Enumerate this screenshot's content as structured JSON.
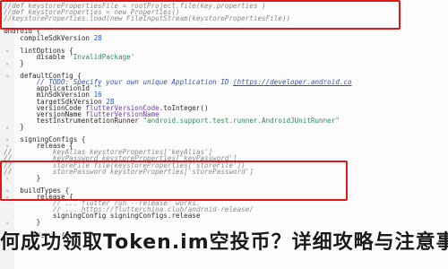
{
  "editor": {
    "lines": [
      {
        "indent": "",
        "text": "//def keystorePropertiesFile = rootProject.file(key.properties )",
        "type": "comment"
      },
      {
        "indent": "",
        "text": "//def keystoreProperties = new Properties()",
        "type": "comment"
      },
      {
        "indent": "",
        "text": "//keystoreProperties.load(new FileInputStream(keystorePropertiesFile))",
        "type": "comment"
      },
      {
        "indent": "",
        "text": "",
        "type": "blank"
      },
      {
        "indent": "",
        "text": "android {",
        "type": "code"
      },
      {
        "indent": "    ",
        "text": "compileSdkVersion 28",
        "type": "code"
      },
      {
        "indent": "",
        "text": "",
        "type": "blank"
      },
      {
        "indent": "    ",
        "text": "lintOptions {",
        "type": "code"
      },
      {
        "indent": "        ",
        "text": "disable 'InvalidPackage'",
        "type": "code"
      },
      {
        "indent": "    ",
        "text": "}",
        "type": "code"
      },
      {
        "indent": "",
        "text": "",
        "type": "blank"
      },
      {
        "indent": "    ",
        "text": "defaultConfig {",
        "type": "code"
      },
      {
        "indent": "        ",
        "text": "// TODO: Specify your own unique Application ID (https://developer.android.co",
        "type": "todo"
      },
      {
        "indent": "        ",
        "text": "applicationId \"\"",
        "type": "code"
      },
      {
        "indent": "        ",
        "text": "minSdkVersion 16",
        "type": "code"
      },
      {
        "indent": "        ",
        "text": "targetSdkVersion 28",
        "type": "code"
      },
      {
        "indent": "        ",
        "text": "versionCode flutterVersionCode.toInteger()",
        "type": "code"
      },
      {
        "indent": "        ",
        "text": "versionName flutterVersionName",
        "type": "code"
      },
      {
        "indent": "        ",
        "text": "testInstrumentationRunner \"android.support.test.runner.AndroidJUnitRunner\"",
        "type": "code"
      },
      {
        "indent": "    ",
        "text": "}",
        "type": "code"
      },
      {
        "indent": "",
        "text": "",
        "type": "blank"
      },
      {
        "indent": "    ",
        "text": "signingConfigs {",
        "type": "code"
      },
      {
        "indent": "        ",
        "text": "release {",
        "type": "code"
      },
      {
        "indent": "//          ",
        "text": "keyAlias keystoreProperties['keyAlias']",
        "type": "comment"
      },
      {
        "indent": "//          ",
        "text": "keyPassword keystoreProperties['keyPassword']",
        "type": "comment"
      },
      {
        "indent": "//          ",
        "text": "storeFile file(keystoreProperties['storeFile'])",
        "type": "comment"
      },
      {
        "indent": "//          ",
        "text": "storePassword keystoreProperties['storePassword']",
        "type": "comment"
      },
      {
        "indent": "        ",
        "text": "}",
        "type": "code"
      },
      {
        "indent": "",
        "text": "",
        "type": "blank"
      },
      {
        "indent": "    ",
        "text": "buildTypes {",
        "type": "code"
      },
      {
        "indent": "        ",
        "text": "release {",
        "type": "code"
      },
      {
        "indent": "            ",
        "text": "// ... flutter run --release' works.",
        "type": "comment"
      },
      {
        "indent": "            ",
        "text": "// ... https://flutterchina.club/android-release/",
        "type": "comment"
      },
      {
        "indent": "            ",
        "text": "signingConfig signingConfigs.release",
        "type": "code"
      },
      {
        "indent": "        ",
        "text": "}",
        "type": "code"
      },
      {
        "indent": "",
        "text": "",
        "type": "blank"
      },
      {
        "indent": "        ",
        "text": "debug {",
        "type": "code"
      }
    ]
  },
  "caption": {
    "text": "何成功领取Token.im空投币？详细攻略与注意事"
  },
  "colors": {
    "highlight_border": "#e01818",
    "comment": "#7a7a7a",
    "number": "#1f5ad6",
    "string": "#2e8b57"
  }
}
